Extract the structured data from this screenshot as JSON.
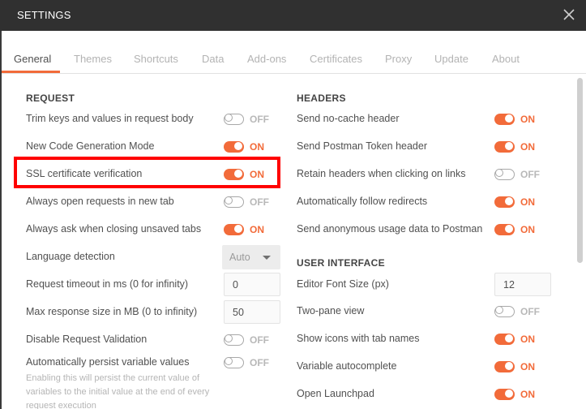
{
  "window": {
    "title": "SETTINGS",
    "close_icon": "close-icon"
  },
  "tabs": [
    {
      "label": "General",
      "active": true
    },
    {
      "label": "Themes"
    },
    {
      "label": "Shortcuts"
    },
    {
      "label": "Data"
    },
    {
      "label": "Add-ons"
    },
    {
      "label": "Certificates"
    },
    {
      "label": "Proxy"
    },
    {
      "label": "Update"
    },
    {
      "label": "About"
    }
  ],
  "colors": {
    "accent": "#f26b3a",
    "titlebar": "#303030",
    "highlight": "#ff0000"
  },
  "request": {
    "heading": "REQUEST",
    "trim_keys": {
      "label": "Trim keys and values in request body",
      "state": "OFF"
    },
    "code_gen": {
      "label": "New Code Generation Mode",
      "state": "ON"
    },
    "ssl": {
      "label": "SSL certificate verification",
      "state": "ON"
    },
    "new_tab": {
      "label": "Always open requests in new tab",
      "state": "OFF"
    },
    "ask_close": {
      "label": "Always ask when closing unsaved tabs",
      "state": "ON"
    },
    "language": {
      "label": "Language detection",
      "value": "Auto"
    },
    "timeout": {
      "label": "Request timeout in ms (0 for infinity)",
      "value": "0"
    },
    "max_size": {
      "label": "Max response size in MB (0 to infinity)",
      "value": "50"
    },
    "disable_validation": {
      "label": "Disable Request Validation",
      "state": "OFF"
    },
    "persist": {
      "label": "Automatically persist variable values",
      "state": "OFF",
      "help": "Enabling this will persist the current value of variables to the initial value at the end of every request execution"
    }
  },
  "headers": {
    "heading": "HEADERS",
    "no_cache": {
      "label": "Send no-cache header",
      "state": "ON"
    },
    "postman_token": {
      "label": "Send Postman Token header",
      "state": "ON"
    },
    "retain": {
      "label": "Retain headers when clicking on links",
      "state": "OFF"
    },
    "redirects": {
      "label": "Automatically follow redirects",
      "state": "ON"
    },
    "usage": {
      "label": "Send anonymous usage data to Postman",
      "state": "ON"
    }
  },
  "ui": {
    "heading": "USER INTERFACE",
    "font_size": {
      "label": "Editor Font Size (px)",
      "value": "12"
    },
    "two_pane": {
      "label": "Two-pane view",
      "state": "OFF"
    },
    "tab_icons": {
      "label": "Show icons with tab names",
      "state": "ON"
    },
    "autocomplete": {
      "label": "Variable autocomplete",
      "state": "ON"
    },
    "launchpad": {
      "label": "Open Launchpad",
      "state": "ON"
    }
  }
}
